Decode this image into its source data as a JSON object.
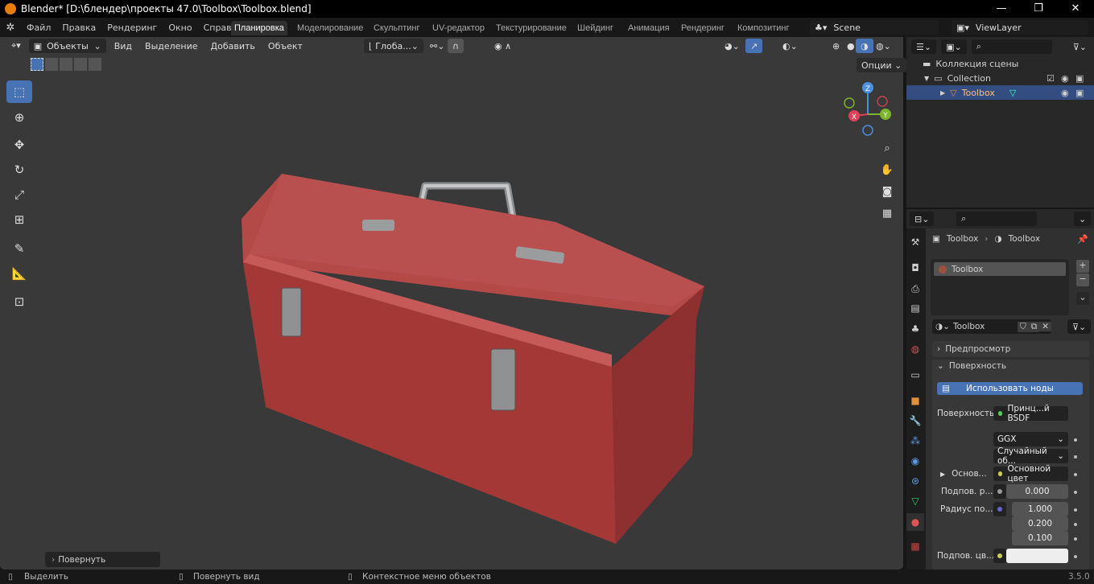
{
  "title": "Blender* [D:\\блендер\\проекты 47.0\\Toolbox\\Toolbox.blend]",
  "window_controls": [
    "—",
    "❐",
    "✕"
  ],
  "menu": [
    "Файл",
    "Правка",
    "Рендеринг",
    "Окно",
    "Справка"
  ],
  "workspaces": [
    "Планировка",
    "Моделирование",
    "Скульптинг",
    "UV-редактор",
    "Текстурирование",
    "Шейдинг",
    "Анимация",
    "Рендеринг",
    "Композитинг"
  ],
  "active_workspace": "Планировка",
  "scene": "Scene",
  "view_layer": "ViewLayer",
  "viewport": {
    "mode": "Объекты",
    "menus": [
      "Вид",
      "Выделение",
      "Добавить",
      "Объект"
    ],
    "orientation": "Глоба...",
    "options": "Опции",
    "last_op": "Повернуть",
    "gizmo": {
      "x": "X",
      "y": "Y",
      "z": "Z"
    }
  },
  "outliner": {
    "scene_collection": "Коллекция сцены",
    "collection": "Collection",
    "object": "Toolbox"
  },
  "properties": {
    "breadcrumb_object": "Toolbox",
    "breadcrumb_material": "Toolbox",
    "slot": "Toolbox",
    "material_name": "Toolbox",
    "panel_preview": "Предпросмотр",
    "panel_surface": "Поверхность",
    "use_nodes": "Использовать ноды",
    "surface_label": "Поверхность",
    "surface_value": "Принц...й BSDF",
    "distribution": "GGX",
    "subsurface_method": "Случайный об...",
    "base_label": "Основ...",
    "base_value": "Основной цвет",
    "subsurface_label": "Подпов. р...",
    "subsurface_value": "0.000",
    "radius_label": "Радиус по...",
    "radius": [
      "1.000",
      "0.200",
      "0.100"
    ],
    "subsurface_color_label": "Подпов. цв..."
  },
  "status": {
    "select": "Выделить",
    "rotate_view": "Повернуть вид",
    "context_menu": "Контекстное меню объектов",
    "version": "3.5.0"
  },
  "colors": {
    "accent": "#4772b3",
    "toolbox_red": "#a83a38",
    "viewport_bg": "#393939"
  }
}
